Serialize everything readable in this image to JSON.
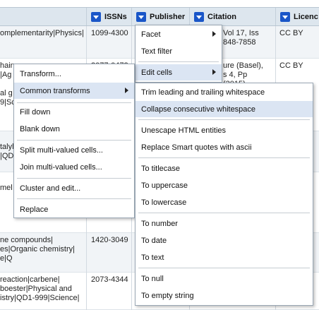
{
  "columns": {
    "issns": "ISSNs",
    "publisher": "Publisher",
    "citation": "Citation",
    "licence": "Licenc"
  },
  "rows": [
    {
      "subjects": "omplementarity|Physics|",
      "issns": "1099-4300",
      "citation": "Vol 17, Iss\n848-7858",
      "licence": "CC BY"
    },
    {
      "subjects": "hain\n|Ag\n\nal g\n9|Sc",
      "issns": "2077-0472",
      "citation": "ure (Basel),\ns 4, Pp\n(2015)",
      "licence": "CC BY"
    },
    {
      "subjects": "talyl\n|QD",
      "issns": "",
      "citation": "",
      "licence": ""
    },
    {
      "subjects": "mel",
      "issns": "",
      "citation": "",
      "licence": ""
    },
    {
      "subjects": "ne compounds|\nes|Organic chemistry|\ne|Q",
      "issns": "1420-3049",
      "citation": "",
      "licence": ""
    },
    {
      "subjects": " reaction|carbene|\nboester|Physical and\nistry|QD1-999|Science|",
      "issns": "2073-4344",
      "citation": "",
      "licence": ""
    }
  ],
  "menu_main": {
    "transform": "Transform...",
    "common_transforms": "Common transforms",
    "fill_down": "Fill down",
    "blank_down": "Blank down",
    "split": "Split multi-valued cells...",
    "join": "Join multi-valued cells...",
    "cluster": "Cluster and edit...",
    "replace": "Replace"
  },
  "menu_column": {
    "facet": "Facet",
    "text_filter": "Text filter",
    "edit_cells": "Edit cells"
  },
  "menu_common": {
    "trim": "Trim leading and trailing whitespace",
    "collapse": "Collapse consecutive whitespace",
    "unescape": "Unescape HTML entities",
    "smart_quotes": "Replace Smart quotes with ascii",
    "titlecase": "To titlecase",
    "uppercase": "To uppercase",
    "lowercase": "To lowercase",
    "number": "To number",
    "date": "To date",
    "text": "To text",
    "null": "To null",
    "empty": "To empty string"
  }
}
